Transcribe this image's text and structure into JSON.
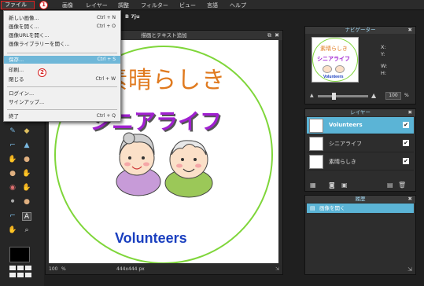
{
  "menubar": {
    "file": "ファイル",
    "items": [
      "画像",
      "レイヤー",
      "調整",
      "フィルター",
      "ビュー",
      "言語",
      "ヘルプ"
    ]
  },
  "callouts": {
    "one": "1",
    "two": "2"
  },
  "file_menu": {
    "items": [
      {
        "label": "新しい画像...",
        "shortcut": "Ctrl + N"
      },
      {
        "label": "画像を開く...",
        "shortcut": "Ctrl + O"
      },
      {
        "label": "画像URLを開く..."
      },
      {
        "label": "画像ライブラリーを開く..."
      },
      {
        "label": "保存...",
        "shortcut": "Ctrl + S"
      },
      {
        "label": "印刷..."
      },
      {
        "label": "閉じる",
        "shortcut": "Ctrl + W"
      },
      {
        "label": "ログイン..."
      },
      {
        "label": "サインアップ..."
      },
      {
        "label": "終了",
        "shortcut": "Ctrl + Q"
      }
    ]
  },
  "toolbar_hint": "B 7ju",
  "canvas": {
    "title": "描画とテキスト追加",
    "status_zoom": "100",
    "status_unit": "%",
    "status_size": "444x444 px"
  },
  "artwork": {
    "heading": "素晴らしき",
    "subtitle": "シニアライフ",
    "footer": "Volunteers",
    "colors": {
      "heading": "#e07a1f",
      "subtitle": "#a020d0",
      "footer": "#1a3fbf",
      "circle": "#7fd63a"
    }
  },
  "navigator": {
    "title": "ナビゲーター",
    "labels": [
      "X:",
      "Y:",
      "W:",
      "H:"
    ],
    "thumb_heading": "素晴らしき",
    "thumb_subtitle": "シニアライフ",
    "thumb_footer": "Volunteers",
    "zoom": "100",
    "unit": "%"
  },
  "layers": {
    "title": "レイヤー",
    "items": [
      {
        "name": "Volunteers",
        "active": true
      },
      {
        "name": "シニアライフ",
        "active": false
      },
      {
        "name": "素晴らしき",
        "active": false
      }
    ]
  },
  "history": {
    "title": "履歴",
    "items": [
      "画像を開く"
    ]
  },
  "colors": {
    "accent": "#5bb4d6",
    "highlight": "#6fb7d8",
    "menu_border": "#e02020"
  }
}
